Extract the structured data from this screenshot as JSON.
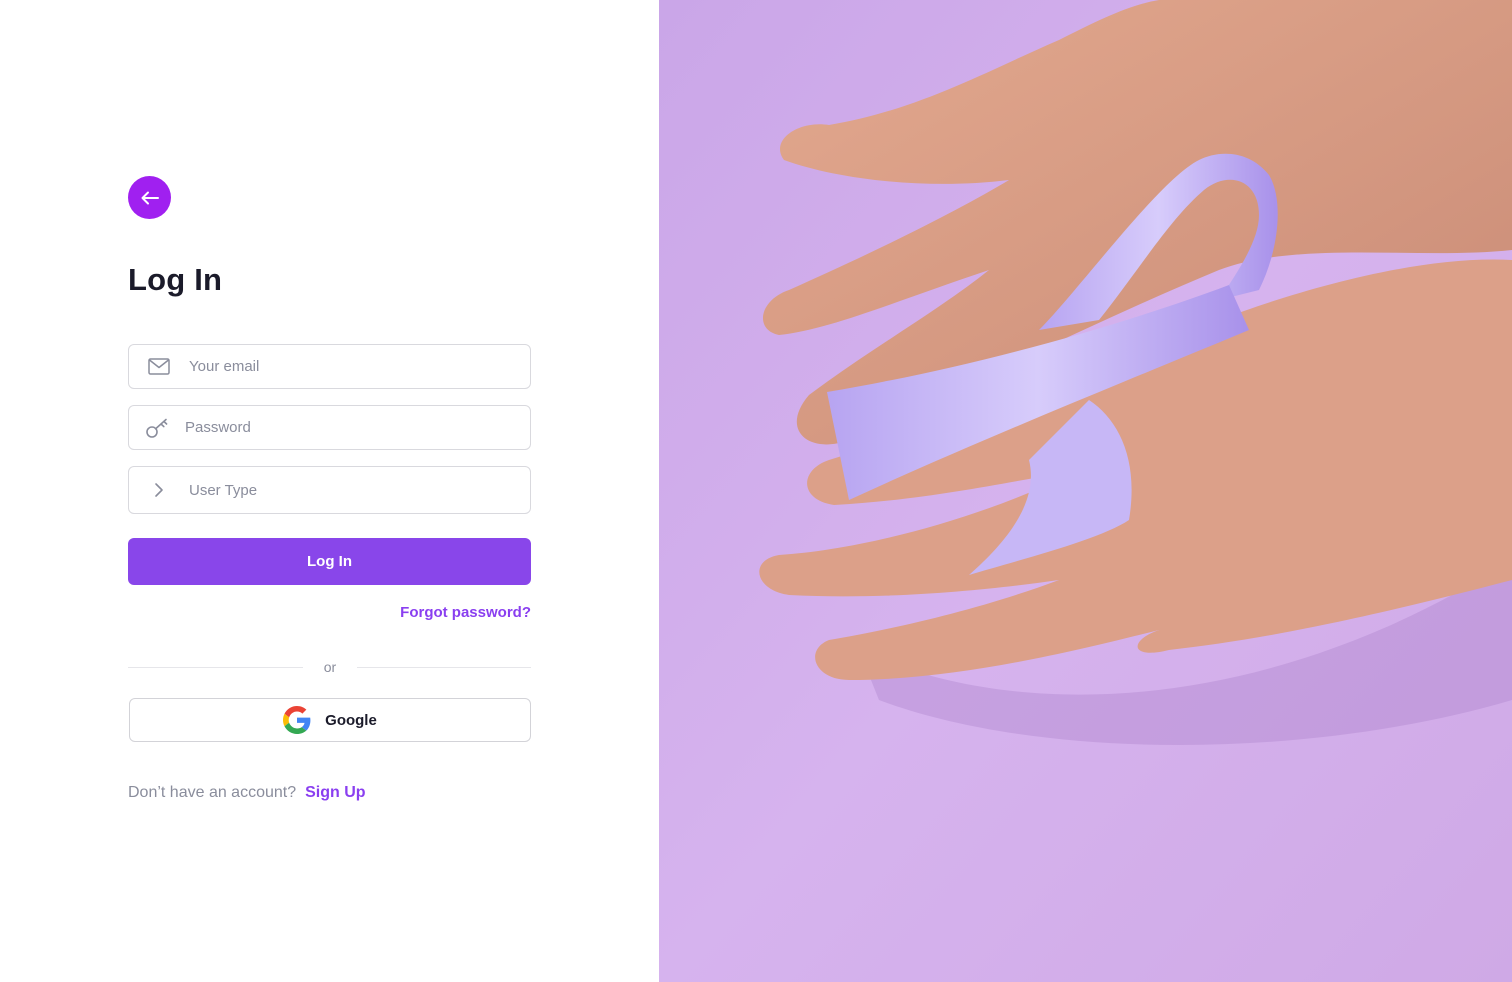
{
  "auth": {
    "title": "Log In",
    "email_placeholder": "Your email",
    "password_placeholder": "Password",
    "user_type_label": "User Type",
    "login_label": "Log In",
    "forgot_label": "Forgot password?",
    "or_label": "or",
    "google_label": "Google",
    "no_account_text": "Don’t have an account?",
    "signup_label": "Sign Up"
  },
  "icons": {
    "back": "arrow-left-icon",
    "email": "mail-icon",
    "password": "key-icon",
    "user_type": "chevron-right-icon",
    "google": "google-logo-icon"
  },
  "colors": {
    "accent": "#8946ea",
    "back_button": "#a020f0",
    "link": "#8a3ff0",
    "hero_background": "#d8b6ea"
  }
}
